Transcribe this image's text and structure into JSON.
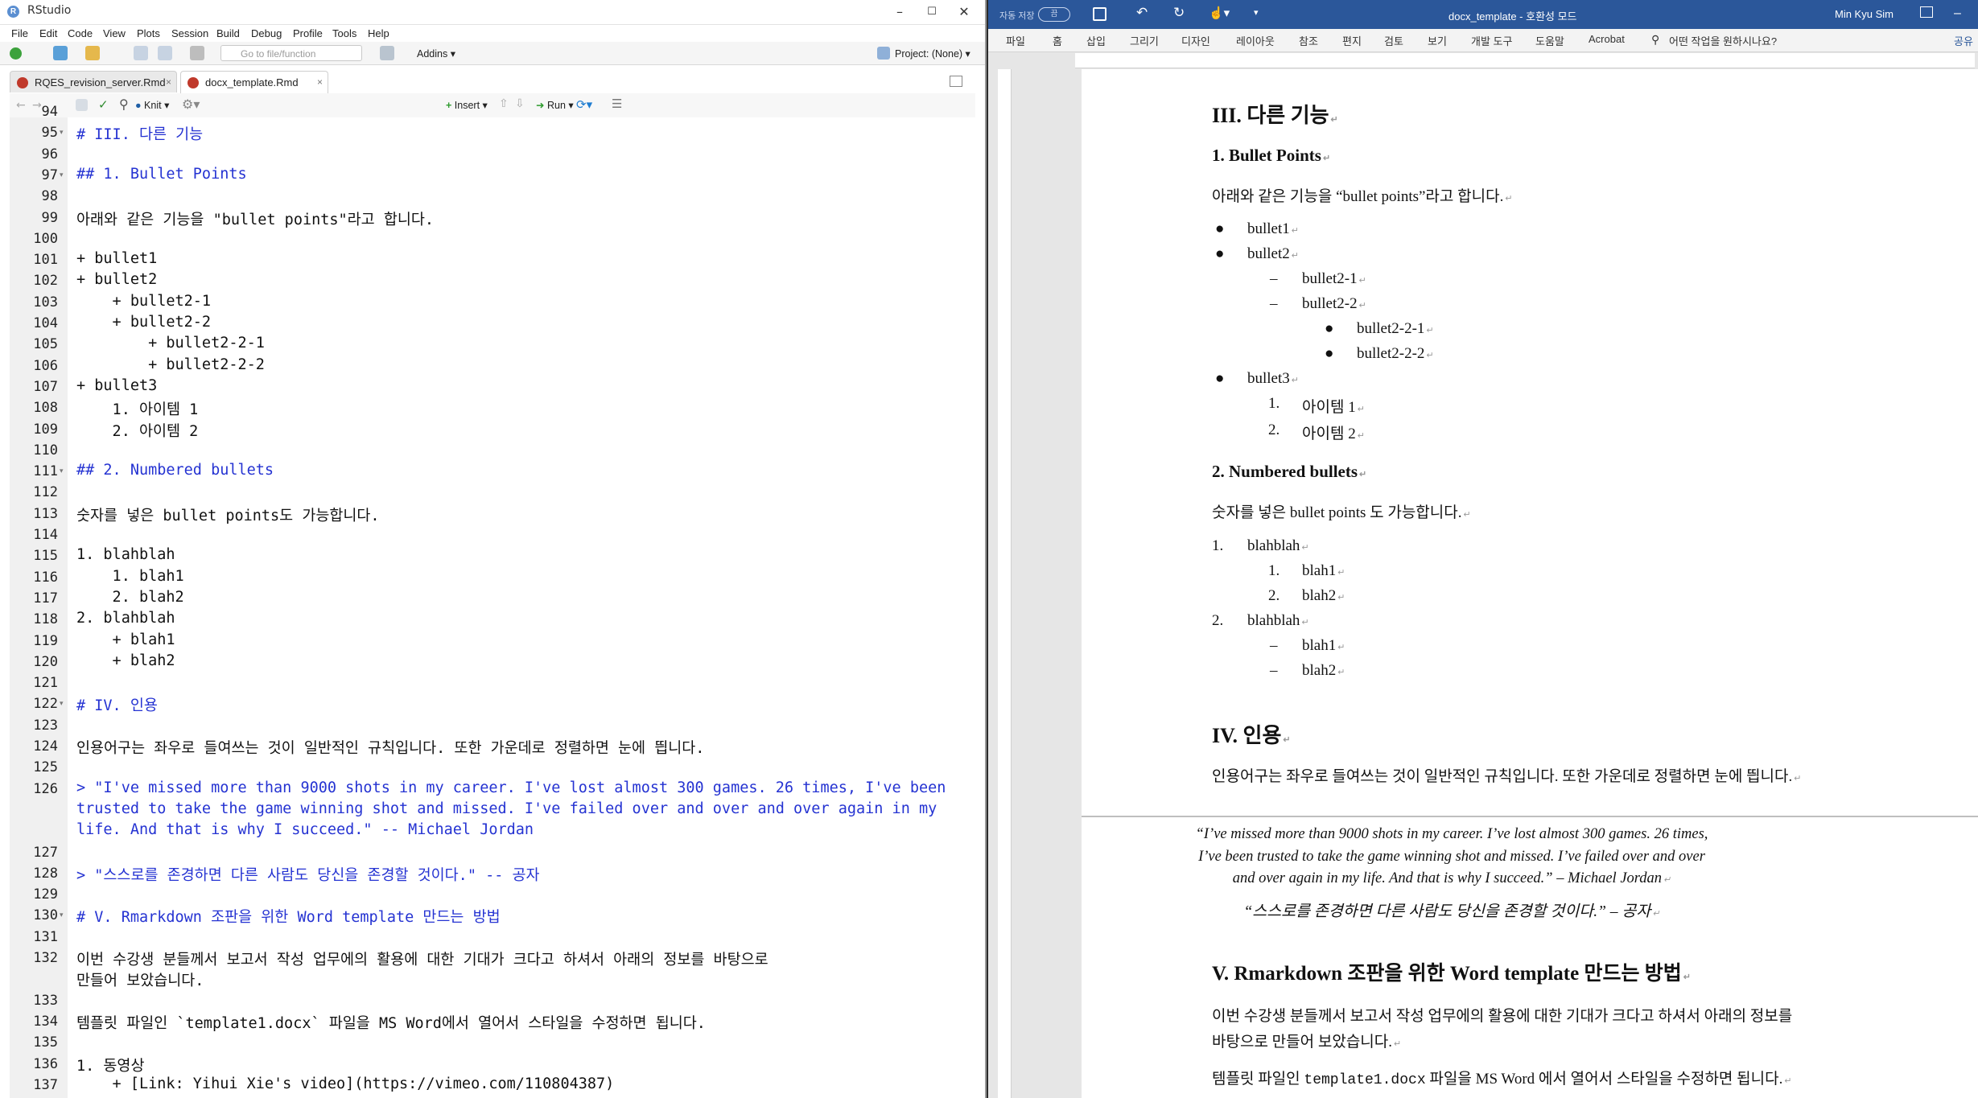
{
  "rstudio": {
    "title": "RStudio",
    "menu": [
      "File",
      "Edit",
      "Code",
      "View",
      "Plots",
      "Session",
      "Build",
      "Debug",
      "Profile",
      "Tools",
      "Help"
    ],
    "goto_placeholder": "Go to file/function",
    "addins": "Addins",
    "project": "Project: (None)",
    "tabs": [
      {
        "label": "RQES_revision_server.Rmd"
      },
      {
        "label": "docx_template.Rmd"
      }
    ],
    "editor_toolbar": {
      "knit": "Knit",
      "insert": "Insert",
      "run": "Run"
    },
    "lines": [
      {
        "n": "94",
        "t": ""
      },
      {
        "n": "95",
        "t": "# III. 다른 기능"
      },
      {
        "n": "96",
        "t": ""
      },
      {
        "n": "97",
        "t": "## 1. Bullet Points"
      },
      {
        "n": "98",
        "t": ""
      },
      {
        "n": "99",
        "t": "아래와 같은 기능을 \"bullet points\"라고 합니다."
      },
      {
        "n": "100",
        "t": ""
      },
      {
        "n": "101",
        "t": "+ bullet1"
      },
      {
        "n": "102",
        "t": "+ bullet2"
      },
      {
        "n": "103",
        "t": "    + bullet2-1"
      },
      {
        "n": "104",
        "t": "    + bullet2-2"
      },
      {
        "n": "105",
        "t": "        + bullet2-2-1"
      },
      {
        "n": "106",
        "t": "        + bullet2-2-2"
      },
      {
        "n": "107",
        "t": "+ bullet3"
      },
      {
        "n": "108",
        "t": "    1. 아이템 1"
      },
      {
        "n": "109",
        "t": "    2. 아이템 2"
      },
      {
        "n": "110",
        "t": ""
      },
      {
        "n": "111",
        "t": "## 2. Numbered bullets"
      },
      {
        "n": "112",
        "t": ""
      },
      {
        "n": "113",
        "t": "숫자를 넣은 bullet points도 가능합니다."
      },
      {
        "n": "114",
        "t": ""
      },
      {
        "n": "115",
        "t": "1. blahblah"
      },
      {
        "n": "116",
        "t": "    1. blah1"
      },
      {
        "n": "117",
        "t": "    2. blah2"
      },
      {
        "n": "118",
        "t": "2. blahblah"
      },
      {
        "n": "119",
        "t": "    + blah1"
      },
      {
        "n": "120",
        "t": "    + blah2"
      },
      {
        "n": "121",
        "t": ""
      },
      {
        "n": "122",
        "t": "# IV. 인용"
      },
      {
        "n": "123",
        "t": ""
      },
      {
        "n": "124",
        "t": "인용어구는 좌우로 들여쓰는 것이 일반적인 규칙입니다. 또한 가운데로 정렬하면 눈에 띕니다."
      },
      {
        "n": "125",
        "t": ""
      },
      {
        "n": "126",
        "t": "> \"I've missed more than 9000 shots in my career. I've lost almost 300 games. 26 times, I've been"
      },
      {
        "n": "",
        "t": "trusted to take the game winning shot and missed. I've failed over and over and over again in my"
      },
      {
        "n": "",
        "t": "life. And that is why I succeed.\" -- Michael Jordan"
      },
      {
        "n": "127",
        "t": ""
      },
      {
        "n": "128",
        "t": "> \"스스로를 존경하면 다른 사람도 당신을 존경할 것이다.\" -- 공자"
      },
      {
        "n": "129",
        "t": ""
      },
      {
        "n": "130",
        "t": "# V. Rmarkdown 조판을 위한 Word template 만드는 방법"
      },
      {
        "n": "131",
        "t": ""
      },
      {
        "n": "132",
        "t": "이번 수강생 분들께서 보고서 작성 업무에의 활용에 대한 기대가 크다고 하셔서 아래의 정보를 바탕으로"
      },
      {
        "n": "",
        "t": "만들어 보았습니다."
      },
      {
        "n": "133",
        "t": ""
      },
      {
        "n": "134",
        "t": "템플릿 파일인 `template1.docx` 파일을 MS Word에서 열어서 스타일을 수정하면 됩니다."
      },
      {
        "n": "135",
        "t": ""
      },
      {
        "n": "136",
        "t": "1. 동영상"
      },
      {
        "n": "137",
        "t": "    + [Link: Yihui Xie's video](https://vimeo.com/110804387)"
      }
    ]
  },
  "word": {
    "autosave": "자동 저장",
    "autosave_state": "끔",
    "doc_title": "docx_template - 호환성 모드",
    "user": "Min Kyu Sim",
    "ribbon_tabs": [
      "파일",
      "홈",
      "삽입",
      "그리기",
      "디자인",
      "레이아웃",
      "참조",
      "편지",
      "검토",
      "보기",
      "개발 도구",
      "도움말",
      "Acrobat"
    ],
    "tell_me": "어떤 작업을 원하시나요?",
    "share": "공유",
    "page1": {
      "h1_iii": "III. 다른 기능",
      "h2_bullets": "1. Bullet Points",
      "p_bullets": "아래와 같은 기능을 “bullet points”라고 합니다.",
      "b1": "bullet1",
      "b2": "bullet2",
      "b21": "bullet2-1",
      "b22": "bullet2-2",
      "b221": "bullet2-2-1",
      "b222": "bullet2-2-2",
      "b3": "bullet3",
      "i1": "아이템 1",
      "i2": "아이템 2",
      "h2_numbered": "2. Numbered bullets",
      "p_numbered": "숫자를 넣은 bullet points 도 가능합니다.",
      "n1": "blahblah",
      "n11": "blah1",
      "n12": "blah2",
      "n2": "blahblah",
      "n21": "blah1",
      "n22": "blah2",
      "h1_iv": "IV. 인용",
      "p_quote_intro": "인용어구는 좌우로 들여쓰는 것이 일반적인 규칙입니다. 또한 가운데로 정렬하면 눈에 띕니다."
    },
    "page2": {
      "quote1_l1": "“I’ve missed more than 9000 shots in my career. I’ve lost almost 300 games. 26 times,",
      "quote1_l2": "I’ve been trusted to take the game winning shot and missed. I’ve failed over and over",
      "quote1_l3": "and over again in my life. And that is why I succeed.” – Michael Jordan",
      "quote2": "“스스로를 존경하면 다른 사람도 당신을 존경할 것이다.” – 공자",
      "h1_v": "V. Rmarkdown 조판을 위한 Word template 만드는 방법",
      "p_v_l1": "이번 수강생 분들께서 보고서 작성 업무에의 활용에 대한 기대가 크다고 하셔서 아래의 정보를",
      "p_v_l2": "바탕으로 만들어 보았습니다.",
      "p_tpl_a": "템플릿 파일인 ",
      "p_tpl_code": "template1.docx",
      "p_tpl_b": " 파일을 MS Word 에서 열어서 스타일을 수정하면 됩니다."
    }
  }
}
